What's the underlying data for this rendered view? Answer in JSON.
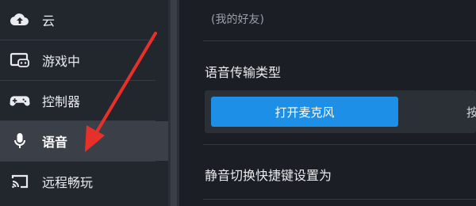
{
  "sidebar": {
    "items": [
      {
        "label": "云",
        "icon": "cloud-upload-icon"
      },
      {
        "label": "游戏中",
        "icon": "in-game-icon"
      },
      {
        "label": "控制器",
        "icon": "controller-icon"
      },
      {
        "label": "语音",
        "icon": "microphone-icon",
        "active": true
      },
      {
        "label": "远程畅玩",
        "icon": "remote-play-icon"
      }
    ]
  },
  "main": {
    "friends_hint": "(我的好友)",
    "voice_transmission_title": "语音传输类型",
    "transmission_options": [
      "打开麦克风",
      "按"
    ],
    "mute_shortcut_title": "静音切换快捷键设置为"
  },
  "colors": {
    "accent": "#1e8fe6",
    "annotation_arrow": "#e8302b",
    "sidebar_bg": "#22262d",
    "active_item_bg": "#3a3f48"
  }
}
